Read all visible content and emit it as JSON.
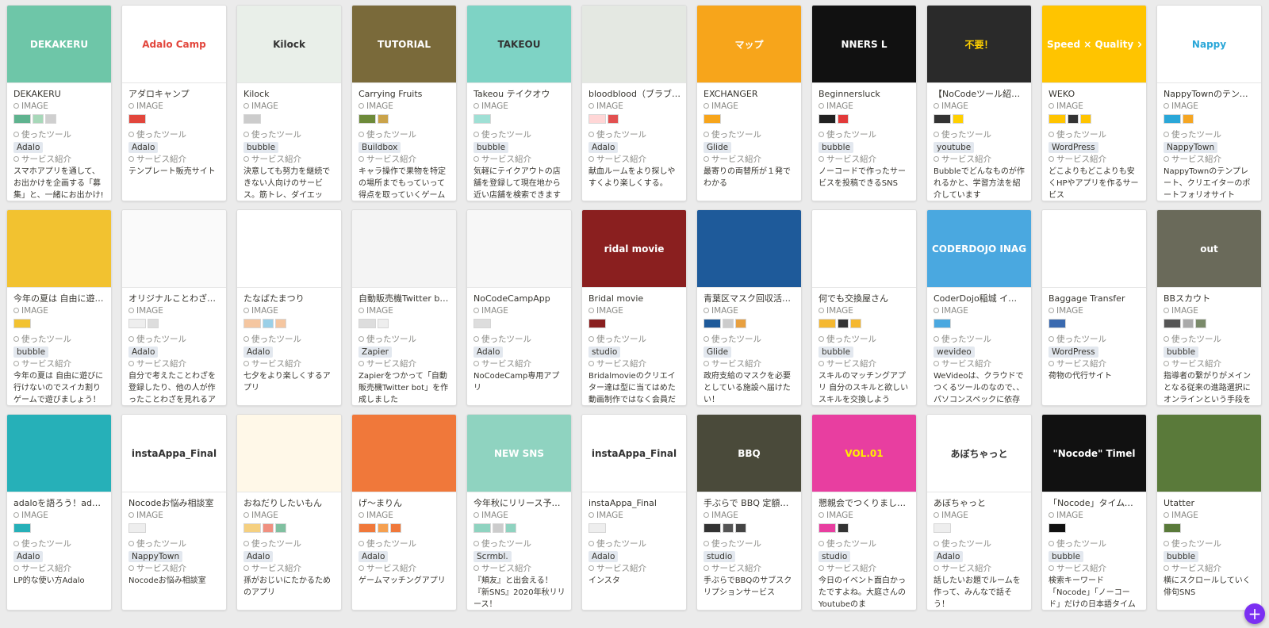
{
  "labels": {
    "type_label": "IMAGE",
    "tools_label": "使ったツール",
    "service_label": "サービス紹介"
  },
  "fab_icon": "+",
  "cards": [
    {
      "title": "DEKAKERU",
      "tool": "Adalo",
      "desc": "スマホアプリを通して、お出かけを企画する「募集」と、一緒にお出かけ!",
      "cover_text": "DEKAKERU",
      "cover_bg": "#6ec6a8",
      "cover_fg": "#ffffff",
      "thumb_colors": [
        "#5fb38f",
        "#a7d8b9",
        "#cfcfcf"
      ]
    },
    {
      "title": "アダロキャンプ",
      "tool": "Adalo",
      "desc": "テンプレート販売サイト",
      "cover_text": "Adalo Camp",
      "cover_bg": "#ffffff",
      "cover_fg": "#e2463c",
      "thumb_colors": [
        "#e2463c"
      ]
    },
    {
      "title": "Kilock",
      "tool": "bubble",
      "desc": "決意しても努力を継続できない人向けのサービス。筋トレ、ダイエット、資格",
      "cover_text": "Kilock",
      "cover_bg": "#e9efe9",
      "cover_fg": "#333333",
      "thumb_colors": [
        "#cccccc"
      ]
    },
    {
      "title": "Carrying Fruits",
      "tool": "Buildbox",
      "desc": "キャラ操作で果物を特定の場所までもっていって得点を取っていくゲームです",
      "cover_text": "TUTORIAL",
      "cover_bg": "#7a6a3a",
      "cover_fg": "#ffffff",
      "thumb_colors": [
        "#6d8a3a",
        "#caa34a"
      ]
    },
    {
      "title": "Takeou テイクオウ",
      "tool": "bubble",
      "desc": "気軽にテイクアウトの店舗を登録して現在地から近い店舗を検索できます",
      "cover_text": "TAKEOU",
      "cover_bg": "#7ed3c5",
      "cover_fg": "#333333",
      "thumb_colors": [
        "#9fe0d5"
      ]
    },
    {
      "title": "bloodblood（ブラブラ）",
      "tool": "Adalo",
      "desc": "献血ルームをより探しやすくより楽しくする。",
      "cover_text": "",
      "cover_bg": "#e4e8e2",
      "cover_fg": "#333333",
      "thumb_colors": [
        "#ffd6d6",
        "#e25050"
      ]
    },
    {
      "title": "EXCHANGER",
      "tool": "Glide",
      "desc": "最寄りの両替所が１発でわかる",
      "cover_text": "マップ",
      "cover_bg": "#f7a51b",
      "cover_fg": "#ffffff",
      "thumb_colors": [
        "#f7a51b"
      ]
    },
    {
      "title": "Beginnersluck",
      "tool": "bubble",
      "desc": "ノーコードで作ったサービスを投稿できるSNS",
      "cover_text": "NNERS L",
      "cover_bg": "#111111",
      "cover_fg": "#ffffff",
      "thumb_colors": [
        "#222222",
        "#e23a3a"
      ]
    },
    {
      "title": "【NoCodeツール紹介】…",
      "tool": "youtube",
      "desc": "Bubbleでどんなものが作れるかと、学習方法を紹介しています",
      "cover_text": "不要！",
      "cover_bg": "#2a2a2a",
      "cover_fg": "#ffd000",
      "thumb_colors": [
        "#333333",
        "#ffd000"
      ]
    },
    {
      "title": "WEKO",
      "tool": "WordPress",
      "desc": "どこよりもどこよりも安くHPやアプリを作るサービス",
      "cover_text": "Speed × Quality × Price",
      "cover_bg": "#ffc400",
      "cover_fg": "#ffffff",
      "thumb_colors": [
        "#ffc400",
        "#333333",
        "#ffc400"
      ]
    },
    {
      "title": "NappyTownのテンプ…",
      "tool": "NappyTown",
      "desc": "NappyTownのテンプレート、クリエイターのポートフォリオサイト",
      "cover_text": "Nappy",
      "cover_bg": "#ffffff",
      "cover_fg": "#2aa7d8",
      "thumb_colors": [
        "#2aa7d8",
        "#f5a623"
      ]
    },
    {
      "title": "今年の夏は 自由に遊…",
      "tool": "bubble",
      "desc": "今年の夏は 自由に遊びに行けないのでスイカ割りゲームで遊びましょう！",
      "cover_text": "",
      "cover_bg": "#f2c230",
      "cover_fg": "#333333",
      "thumb_colors": [
        "#f2c230"
      ]
    },
    {
      "title": "オリジナルことわざ辞典",
      "tool": "Adalo",
      "desc": "自分で考えたことわざを登録したり、他の人が作ったことわざを見れるアプ",
      "cover_text": "",
      "cover_bg": "#fafafa",
      "cover_fg": "#333333",
      "thumb_colors": [
        "#eeeeee",
        "#dddddd"
      ]
    },
    {
      "title": "たなばたまつり",
      "tool": "Adalo",
      "desc": "七夕をより楽しくするアプリ",
      "cover_text": "",
      "cover_bg": "#ffffff",
      "cover_fg": "#333333",
      "thumb_colors": [
        "#f5c6a0",
        "#9ad0e8",
        "#f5c6a0"
      ]
    },
    {
      "title": "自動販売機Twitter b…",
      "tool": "Zapier",
      "desc": "Zapierをつかって「自動販売機Twitter bot」を作成しました",
      "cover_text": "",
      "cover_bg": "#f4f4f4",
      "cover_fg": "#333333",
      "thumb_colors": [
        "#dddddd",
        "#eeeeee"
      ]
    },
    {
      "title": "NoCodeCampApp",
      "tool": "Adalo",
      "desc": "NoCodeCamp専用アプリ",
      "cover_text": "",
      "cover_bg": "#f7f7f7",
      "cover_fg": "#333333",
      "thumb_colors": [
        "#dddddd"
      ]
    },
    {
      "title": "Bridal movie",
      "tool": "studio",
      "desc": "Bridalmovieのクリエイター達は型に当てはめた動画制作ではなく会員だけ",
      "cover_text": "ridal movie",
      "cover_bg": "#8a1f1f",
      "cover_fg": "#ffffff",
      "thumb_colors": [
        "#8a1f1f"
      ]
    },
    {
      "title": "青葉区マスク回収活…",
      "tool": "Glide",
      "desc": "政府支給のマスクを必要としている施設へ届けたい！",
      "cover_text": "",
      "cover_bg": "#1e5a9a",
      "cover_fg": "#ffffff",
      "thumb_colors": [
        "#1e5a9a",
        "#cccccc",
        "#e8a040"
      ]
    },
    {
      "title": "何でも交換屋さん",
      "tool": "bubble",
      "desc": "スキルのマッチングアプリ 自分のスキルと欲しいスキルを交換しよう",
      "cover_text": "",
      "cover_bg": "#ffffff",
      "cover_fg": "#333333",
      "thumb_colors": [
        "#f5b830",
        "#333333",
        "#f5b830"
      ]
    },
    {
      "title": "CoderDojo稲城 イベ…",
      "tool": "wevideo",
      "desc": "WeVideoは、クラウドでつくるツールのなので、、パソコンスペックに依存しな",
      "cover_text": "CODERDOJO INAGI",
      "cover_bg": "#4aa8e0",
      "cover_fg": "#ffffff",
      "thumb_colors": [
        "#4aa8e0"
      ]
    },
    {
      "title": "Baggage Transfer",
      "tool": "WordPress",
      "desc": "荷物の代行サイト",
      "cover_text": "",
      "cover_bg": "#ffffff",
      "cover_fg": "#333333",
      "thumb_colors": [
        "#3a6ab0"
      ]
    },
    {
      "title": "BBスカウト",
      "tool": "bubble",
      "desc": "指導者の繋がりがメインとなる従来の進路選択にオンラインという手段を",
      "cover_text": "out",
      "cover_bg": "#6a6a5a",
      "cover_fg": "#ffffff",
      "thumb_colors": [
        "#555555",
        "#aaaaaa",
        "#7a8a6a"
      ]
    },
    {
      "title": "adaloを語ろう！adal…",
      "tool": "Adalo",
      "desc": "LP的な使い方Adalo",
      "cover_text": "",
      "cover_bg": "#26b0b8",
      "cover_fg": "#ffffff",
      "thumb_colors": [
        "#26b0b8"
      ]
    },
    {
      "title": "Nocodeお悩み相談室",
      "tool": "NappyTown",
      "desc": "Nocodeお悩み相談室",
      "cover_text": "instaAppa_Final",
      "cover_bg": "#ffffff",
      "cover_fg": "#333333",
      "thumb_colors": [
        "#eeeeee"
      ]
    },
    {
      "title": "おねだりしたいもん",
      "tool": "Adalo",
      "desc": "孫がおじいにたかるためのアプリ",
      "cover_text": "",
      "cover_bg": "#fff8e8",
      "cover_fg": "#333333",
      "thumb_colors": [
        "#f5d080",
        "#f09080",
        "#80c0a0"
      ]
    },
    {
      "title": "げ～まりん",
      "tool": "Adalo",
      "desc": "ゲームマッチングアプリ",
      "cover_text": "",
      "cover_bg": "#f0783a",
      "cover_fg": "#ffffff",
      "thumb_colors": [
        "#f0783a",
        "#f5a050",
        "#f0783a"
      ]
    },
    {
      "title": "今年秋にリリース予定…",
      "tool": "Scrmbl.",
      "desc": "『頬友』と出会える！『新SNS』2020年秋リリース！",
      "cover_text": "NEW SNS",
      "cover_bg": "#8fd3c0",
      "cover_fg": "#ffffff",
      "thumb_colors": [
        "#8fd3c0",
        "#cccccc",
        "#8fd3c0"
      ]
    },
    {
      "title": "instaAppa_Final",
      "tool": "Adalo",
      "desc": "インスタ",
      "cover_text": "instaAppa_Final",
      "cover_bg": "#ffffff",
      "cover_fg": "#333333",
      "thumb_colors": [
        "#eeeeee"
      ]
    },
    {
      "title": "手ぶらで BBQ 定額サ…",
      "tool": "studio",
      "desc": "手ぶらでBBQのサブスクリプションサービス",
      "cover_text": "BBQ",
      "cover_bg": "#4a4a3a",
      "cover_fg": "#ffffff",
      "thumb_colors": [
        "#333333",
        "#555555",
        "#444444"
      ]
    },
    {
      "title": "懇親会でつくりましたべ…",
      "tool": "studio",
      "desc": "今日のイベント面白かったですよね。大庭さんのYoutubeのま",
      "cover_text": "VOL.01",
      "cover_bg": "#e83ea0",
      "cover_fg": "#ffee00",
      "thumb_colors": [
        "#e83ea0",
        "#333333"
      ]
    },
    {
      "title": "あぼちゃっと",
      "tool": "Adalo",
      "desc": "話したいお題でルームを作って、みんなで話そう！",
      "cover_text": "あぼちゃっと",
      "cover_bg": "#ffffff",
      "cover_fg": "#333333",
      "thumb_colors": [
        "#eeeeee"
      ]
    },
    {
      "title": "「Nocode」タイムライン",
      "tool": "bubble",
      "desc": "検索キーワード「Nocode」「ノーコード」だけの日本語タイムライ",
      "cover_text": "\"Nocode\" Timel",
      "cover_bg": "#111111",
      "cover_fg": "#ffffff",
      "thumb_colors": [
        "#111111"
      ]
    },
    {
      "title": "Utatter",
      "tool": "bubble",
      "desc": "横にスクロールしていく俳句SNS",
      "cover_text": "",
      "cover_bg": "#5a7a3a",
      "cover_fg": "#ffffff",
      "thumb_colors": [
        "#5a7a3a"
      ]
    }
  ]
}
